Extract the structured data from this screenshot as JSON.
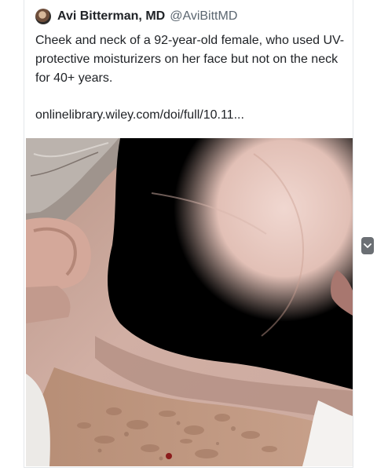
{
  "tweet": {
    "author_name": "Avi Bitterman, MD",
    "author_handle": "@AviBittMD",
    "text": "Cheek and neck of a 92-year-old female, who used UV-protective moisturizers on her face but not on the neck for 40+ years.",
    "link_text": "onlinelibrary.wiley.com/doi/full/10.11..."
  },
  "icons": {
    "avatar": "avatar",
    "scroll": "chevron-down-icon"
  },
  "colors": {
    "text": "#202327",
    "handle": "#5b6670",
    "scroll_knob": "#6b6f74"
  }
}
